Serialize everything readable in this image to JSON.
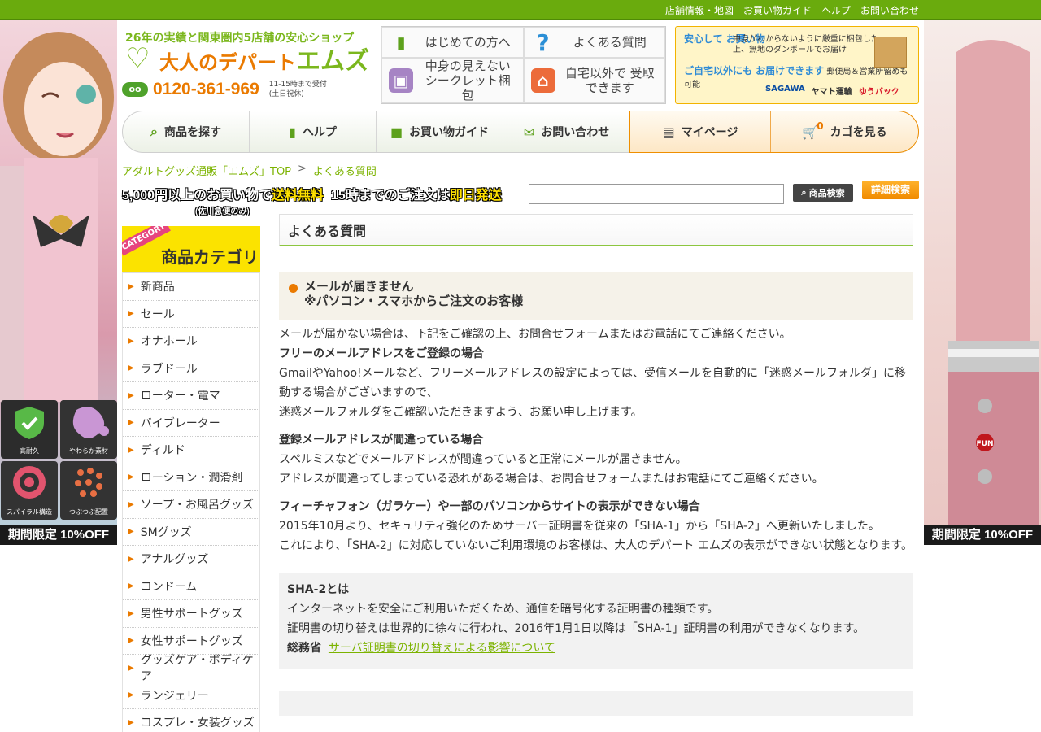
{
  "top_links": [
    "店舗情報・地図",
    "お買い物ガイド",
    "ヘルプ",
    "お問い合わせ"
  ],
  "ads": {
    "left_banner": "期間限定 10%OFF",
    "left_features": [
      "高耐久",
      "やわらか素材",
      "スパイラル構造",
      "つぶつぶ配置"
    ],
    "right_banner": "期間限定 10%OFF",
    "right_product_logo": "FUN"
  },
  "header": {
    "tagline_pre": "26年の実績と関東圏内5店舗の安心ショップ",
    "brand_prefix": "大人のデパート",
    "brand_name": "エムズ",
    "phone_badge": "oo",
    "phone": "0120-361-969",
    "hours_line1": "11-15時まで受付",
    "hours_line2": "(土日祝休)"
  },
  "quick_links": [
    {
      "label": "はじめての方へ",
      "icon": "beginner-mark-icon"
    },
    {
      "label": "よくある質問",
      "icon": "question-icon"
    },
    {
      "label": "中身の見えない シークレット梱包",
      "icon": "box-icon"
    },
    {
      "label": "自宅以外で 受取できます",
      "icon": "pickup-icon"
    }
  ],
  "promo": {
    "title1": "安心して お買い物",
    "text1": "中身がわからないように厳重に梱包した上、無地のダンボールでお届け",
    "title2": "ご自宅以外にも お届けできます",
    "text2": "郵便局＆営業所留めも可能",
    "carriers": [
      "SAGAWA",
      "ヤマト運輸",
      "ゆうパック"
    ]
  },
  "global_nav": [
    {
      "label": "商品を探す",
      "icon": "search-icon"
    },
    {
      "label": "ヘルプ",
      "icon": "beginner-mark-icon"
    },
    {
      "label": "お買い物ガイド",
      "icon": "bag-icon"
    },
    {
      "label": "お問い合わせ",
      "icon": "mail-icon"
    },
    {
      "label": "マイページ",
      "icon": "calendar-icon"
    },
    {
      "label": "カゴを見る",
      "icon": "cart-icon",
      "cart_count": "0"
    }
  ],
  "breadcrumb": {
    "home": "アダルトグッズ通販「エムズ」TOP",
    "sep": ">",
    "current": "よくある質問"
  },
  "shipping_banner": {
    "part1": "5,000円以上のお買い物で",
    "part2": "送料無料",
    "part3": "15時までのご注文は",
    "part4": "即日発送",
    "note": "(佐川急便のみ)"
  },
  "search": {
    "placeholder": "",
    "button": "商品検索",
    "advanced": "詳細検索"
  },
  "categories": {
    "ribbon": "CATEGORY",
    "title": "商品カテゴリ",
    "items": [
      "新商品",
      "セール",
      "オナホール",
      "ラブドール",
      "ローター・電マ",
      "バイブレーター",
      "ディルド",
      "ローション・潤滑剤",
      "ソープ・お風呂グッズ",
      "SMグッズ",
      "アナルグッズ",
      "コンドーム",
      "男性サポートグッズ",
      "女性サポートグッズ",
      "グッズケア・ボディケア",
      "ランジェリー",
      "コスプレ・女装グッズ"
    ]
  },
  "main": {
    "page_title": "よくある質問",
    "question_line1": "メールが届きません",
    "question_line2": "※パソコン・スマホからご注文のお客様",
    "intro": "メールが届かない場合は、下記をご確認の上、お問合せフォームまたはお電話にてご連絡ください。",
    "s1_title": "フリーのメールアドレスをご登録の場合",
    "s1_p1": "GmailやYahoo!メールなど、フリーメールアドレスの設定によっては、受信メールを自動的に「迷惑メールフォルダ」に移動する場合がございますので、",
    "s1_p2": "迷惑メールフォルダをご確認いただきますよう、お願い申し上げます。",
    "s2_title": "登録メールアドレスが間違っている場合",
    "s2_p1": "スペルミスなどでメールアドレスが間違っていると正常にメールが届きません。",
    "s2_p2": "アドレスが間違ってしまっている恐れがある場合は、お問合せフォームまたはお電話にてご連絡ください。",
    "s3_title": "フィーチャフォン（ガラケー）や一部のパソコンからサイトの表示ができない場合",
    "s3_p1": "2015年10月より、セキュリティ強化のためサーバー証明書を従来の「SHA-1」から「SHA-2」へ更新いたしました。",
    "s3_p2": "これにより、「SHA-2」に対応していないご利用環境のお客様は、大人のデパート エムズの表示ができない状態となります。",
    "info_title": "SHA-2とは",
    "info_p1": "インターネットを安全にご利用いただくため、通信を暗号化する証明書の種類です。",
    "info_p2": "証明書の切り替えは世界的に徐々に行われ、2016年1月1日以降は「SHA-1」証明書の利用ができなくなります。",
    "info_org": "総務省",
    "info_link": "サーバ証明書の切り替えによる影響について"
  }
}
